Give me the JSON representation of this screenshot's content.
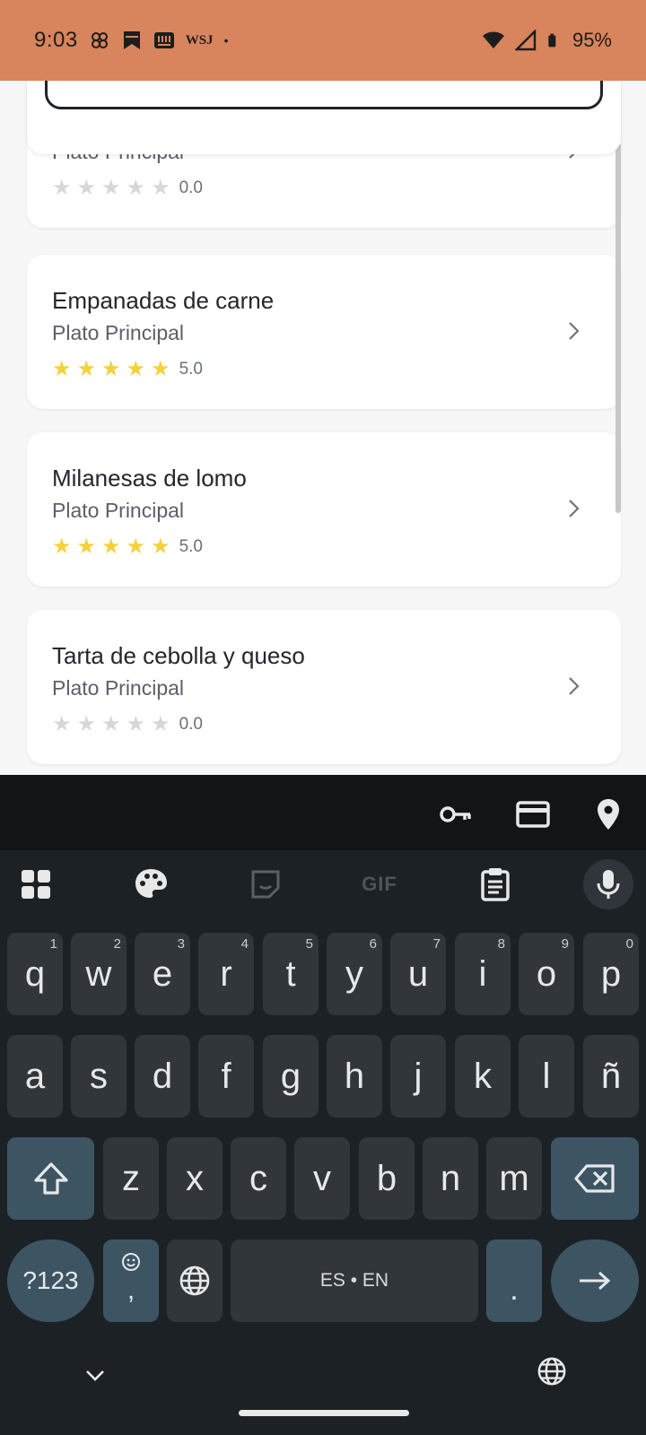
{
  "status_bar": {
    "time": "9:03",
    "notif_icons": [
      "pinwheel-icon",
      "bookmark-icon",
      "news-icon"
    ],
    "wsj": "WSJ",
    "dot": "•",
    "battery": "95%",
    "bg_color": "#d8845c"
  },
  "search": {
    "value": "",
    "placeholder": ""
  },
  "dishes": [
    {
      "name": "",
      "category": "Plato Principal",
      "rating": "0.0",
      "stars_filled": 0
    },
    {
      "name": "Empanadas de carne",
      "category": "Plato Principal",
      "rating": "5.0",
      "stars_filled": 5
    },
    {
      "name": "Milanesas de lomo",
      "category": "Plato Principal",
      "rating": "5.0",
      "stars_filled": 5
    },
    {
      "name": "Tarta de cebolla y queso",
      "category": "Plato Principal",
      "rating": "0.0",
      "stars_filled": 0
    }
  ],
  "keyboard": {
    "suggestion_icons": [
      "key-icon",
      "credit-card-icon",
      "location-pin-icon"
    ],
    "toolbar": {
      "apps": "apps-icon",
      "theme": "palette-icon",
      "sticker": "sticker-icon",
      "gif": "GIF",
      "clipboard": "clipboard-icon",
      "mic": "microphone-icon"
    },
    "row1": [
      {
        "k": "q",
        "h": "1"
      },
      {
        "k": "w",
        "h": "2"
      },
      {
        "k": "e",
        "h": "3"
      },
      {
        "k": "r",
        "h": "4"
      },
      {
        "k": "t",
        "h": "5"
      },
      {
        "k": "y",
        "h": "6"
      },
      {
        "k": "u",
        "h": "7"
      },
      {
        "k": "i",
        "h": "8"
      },
      {
        "k": "o",
        "h": "9"
      },
      {
        "k": "p",
        "h": "0"
      }
    ],
    "row2": [
      "a",
      "s",
      "d",
      "f",
      "g",
      "h",
      "j",
      "k",
      "l",
      "ñ"
    ],
    "row3": [
      "z",
      "x",
      "c",
      "v",
      "b",
      "n",
      "m"
    ],
    "sym_label": "?123",
    "comma": ",",
    "space_label": "ES • EN",
    "period": ".",
    "star_glyph": "★",
    "accent_key_color": "#3d5563",
    "star_color": "#f4d13d"
  }
}
